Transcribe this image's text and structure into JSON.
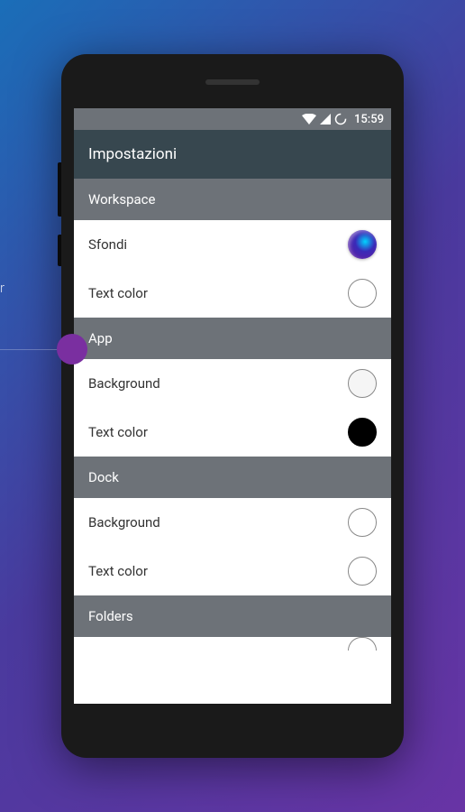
{
  "statusBar": {
    "time": "15:59"
  },
  "header": {
    "title": "Impostazioni"
  },
  "sections": [
    {
      "name": "Workspace",
      "items": [
        {
          "label": "Sfondi",
          "swatch": "gradient"
        },
        {
          "label": "Text color",
          "swatch": "white"
        }
      ]
    },
    {
      "name": "App",
      "items": [
        {
          "label": "Background",
          "swatch": "light"
        },
        {
          "label": "Text color",
          "swatch": "black"
        }
      ]
    },
    {
      "name": "Dock",
      "items": [
        {
          "label": "Background",
          "swatch": "white"
        },
        {
          "label": "Text color",
          "swatch": "white"
        }
      ]
    },
    {
      "name": "Folders",
      "items": []
    }
  ],
  "bgText": "r"
}
